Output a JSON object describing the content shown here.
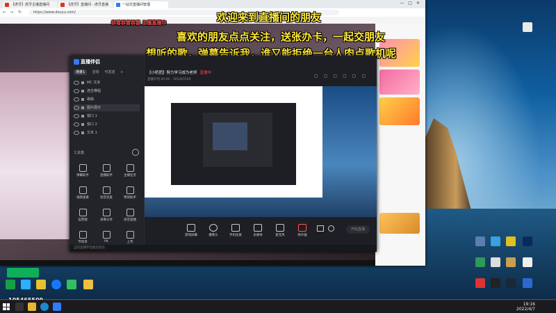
{
  "browser": {
    "tabs": [
      {
        "label": "【虎牙】虎牙主播直播间"
      },
      {
        "label": "【虎牙】直播间 - 虎牙直播"
      },
      {
        "label": "一站式直播间管理"
      }
    ],
    "url": "https://www.douyu.com/"
  },
  "overlay": {
    "line1": "欢迎来到直播间的朋友",
    "line2": "喜欢的朋友点点关注，送张办卡，一起交朋友",
    "line3": "想听的歌，弹幕告诉我，谁又能拒绝一台人肉点歌机呢",
    "banner": "恭喜恭喜恭喜 主播直播中"
  },
  "app": {
    "brand": "直播伴侣",
    "scene_tabs": [
      "场景1",
      "音效",
      "可发送"
    ],
    "sources": [
      {
        "label": "MC 文本"
      },
      {
        "label": "连击横幅"
      },
      {
        "label": "歌曲"
      },
      {
        "label": "图片展示"
      },
      {
        "label": "窗口 1"
      },
      {
        "label": "窗口 2"
      },
      {
        "label": "文本 1"
      }
    ],
    "tools_title": "工具箱",
    "tools": [
      {
        "label": "弹幕助手",
        "icon": "chat-icon"
      },
      {
        "label": "直播助手",
        "icon": "user-icon"
      },
      {
        "label": "主播任务",
        "icon": "task-icon"
      },
      {
        "label": "视频速素",
        "icon": "video-icon"
      },
      {
        "label": "语音连麦",
        "icon": "mic-icon"
      },
      {
        "label": "特效助手",
        "icon": "effect-icon"
      },
      {
        "label": "运营端",
        "icon": "gear-icon"
      },
      {
        "label": "录像分享",
        "icon": "record-icon"
      },
      {
        "label": "语音直播",
        "icon": "voice-icon"
      },
      {
        "label": "节目单",
        "icon": "list-icon"
      },
      {
        "label": "PK",
        "icon": "pk-icon"
      },
      {
        "label": "上传",
        "icon": "upload-icon"
      }
    ],
    "title": "【小奶团】努力学习成为老师",
    "title_tag": "直播中",
    "subtitle": "直播计时 00:00 · 105465509",
    "bottom_buttons": [
      {
        "label": "游戏屏幕",
        "icon": "monitor-icon"
      },
      {
        "label": "摄像头",
        "icon": "camera-icon"
      },
      {
        "label": "手机投屏",
        "icon": "phone-icon"
      },
      {
        "label": "多媒体",
        "icon": "media-icon"
      },
      {
        "label": "麦克风",
        "icon": "mic-icon"
      },
      {
        "label": "扬声器",
        "icon": "speaker-icon"
      }
    ],
    "live_button": "开始直播",
    "status": "当前直播伴侣推流状态"
  },
  "watermark": {
    "room_id": "105465509"
  },
  "taskbar": {
    "time": "19:16",
    "date": "2022/4/7"
  }
}
